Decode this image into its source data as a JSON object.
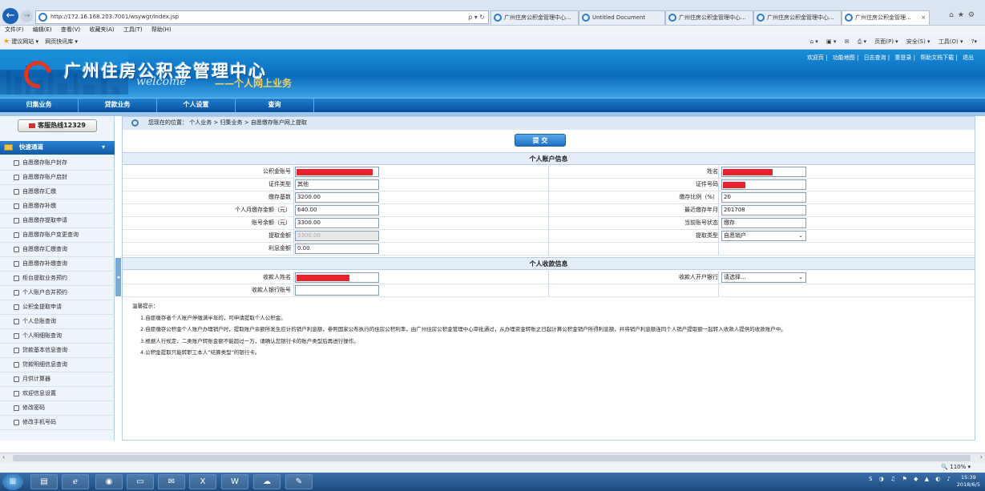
{
  "browser": {
    "url": "http://172.16.168.203:7001/wsywgr/index.jsp",
    "addr_tools": "ρ ▾ ↻",
    "tabs": [
      {
        "label": "广州住房公积金管理中心..."
      },
      {
        "label": "Untitled Document"
      },
      {
        "label": "广州住房公积金管理中心..."
      },
      {
        "label": "广州住房公积金管理中心..."
      },
      {
        "label": "广州住房公积金管理..."
      }
    ],
    "tab_close": "×",
    "menu": [
      "文件(F)",
      "编辑(E)",
      "查看(V)",
      "收藏夹(A)",
      "工具(T)",
      "帮助(H)"
    ],
    "favorites": [
      "建议网站 ▾",
      "网页快讯库 ▾"
    ],
    "commands": [
      "页面(P) ▾",
      "安全(S) ▾",
      "工具(O) ▾"
    ]
  },
  "site": {
    "title": "广州住房公积金管理中心",
    "welcome": "welcome",
    "welcome_cn": "——个人网上业务",
    "toplinks": [
      "欢迎页",
      "功能地图",
      "日志查询",
      "重登录",
      "帮助文档下载",
      "退出"
    ],
    "nav": [
      "归集业务",
      "贷款业务",
      "个人设置",
      "查询"
    ]
  },
  "sidebar": {
    "hotline": "客服热线12329",
    "quick_title": "快速通道",
    "items": [
      {
        "label": "自愿缴存账户封存"
      },
      {
        "label": "自愿缴存账户启封"
      },
      {
        "label": "自愿缴存汇缴"
      },
      {
        "label": "自愿缴存补缴"
      },
      {
        "label": "自愿缴存提取申请"
      },
      {
        "label": "自愿缴存账户变更查询"
      },
      {
        "label": "自愿缴存汇缴查询"
      },
      {
        "label": "自愿缴存补缴查询"
      },
      {
        "label": "柜台提取业务预约"
      },
      {
        "label": "个人账户合并预约"
      },
      {
        "label": "公积金提取申请"
      },
      {
        "label": "个人总账查询"
      },
      {
        "label": "个人明细账查询"
      },
      {
        "label": "贷款基本信息查询"
      },
      {
        "label": "贷款明细信息查询"
      },
      {
        "label": "月供计算器"
      },
      {
        "label": "欢迎信息设置"
      },
      {
        "label": "修改密码"
      },
      {
        "label": "修改手机号码"
      }
    ]
  },
  "main": {
    "breadcrumb": "您现在的位置：  个人业务  > 归集业务  > 自愿缴存账户网上提取",
    "submit": "提 交",
    "account_section": "个人账户信息",
    "fields": {
      "gjj_no_label": "公积金账号",
      "name_label": "姓名",
      "id_type_label": "证件类型",
      "id_type_value": "其他",
      "id_no_label": "证件号码",
      "base_label": "缴存基数",
      "base_value": "3200.00",
      "ratio_label": "缴存比例（%）",
      "ratio_value": "20",
      "monthly_label": "个人月缴存金额（元）",
      "monthly_value": "640.00",
      "last_month_label": "最近缴存年月",
      "last_month_value": "201708",
      "balance_label": "账号余额（元）",
      "balance_value": "3300.00",
      "status_label": "当前账号状态",
      "status_value": "缴存",
      "amount_label": "提取金额",
      "amount_value": "3300.00",
      "type_label": "提取类型",
      "type_value": "自愿销户",
      "interest_label": "利息金额",
      "interest_value": "0.00"
    },
    "payee_section": "个人收款信息",
    "payee": {
      "name_label": "收款人姓名",
      "bank_label": "收款人开户银行",
      "bank_value": "请选择...",
      "account_label": "收款人银行账号"
    },
    "tips_title": "温馨提示：",
    "tips": [
      "1.自愿缴存者个人账户停缴满半年的，可申请提取个人公积金。",
      "2.自愿缴存公积金个人账户办理销户时，提取账户余额所发生应计的销户利息额，参照国家公布执行的住房公积利率，由广州住房公积金管理中心审批通过，从办理资金转账之日起计算公积金销户所得利息额，并将销户利息额连同个人销户提取额一起转入收款人提供的收款账户中。",
      "3.根据人行规定，二类账户转账金额不能超过一万，请确认您银行卡的账户类型后再进行操作。",
      "4.公积金提取只能转职工本人“结算类型”的银行卡。"
    ]
  },
  "status": {
    "zoom": "110%"
  },
  "taskbar": {
    "time": "15:39",
    "date": "2018/6/5"
  },
  "colors": {
    "header_blue": "#0c6bbd",
    "nav_blue": "#0a4f9c",
    "redaction": "#e8232b"
  }
}
